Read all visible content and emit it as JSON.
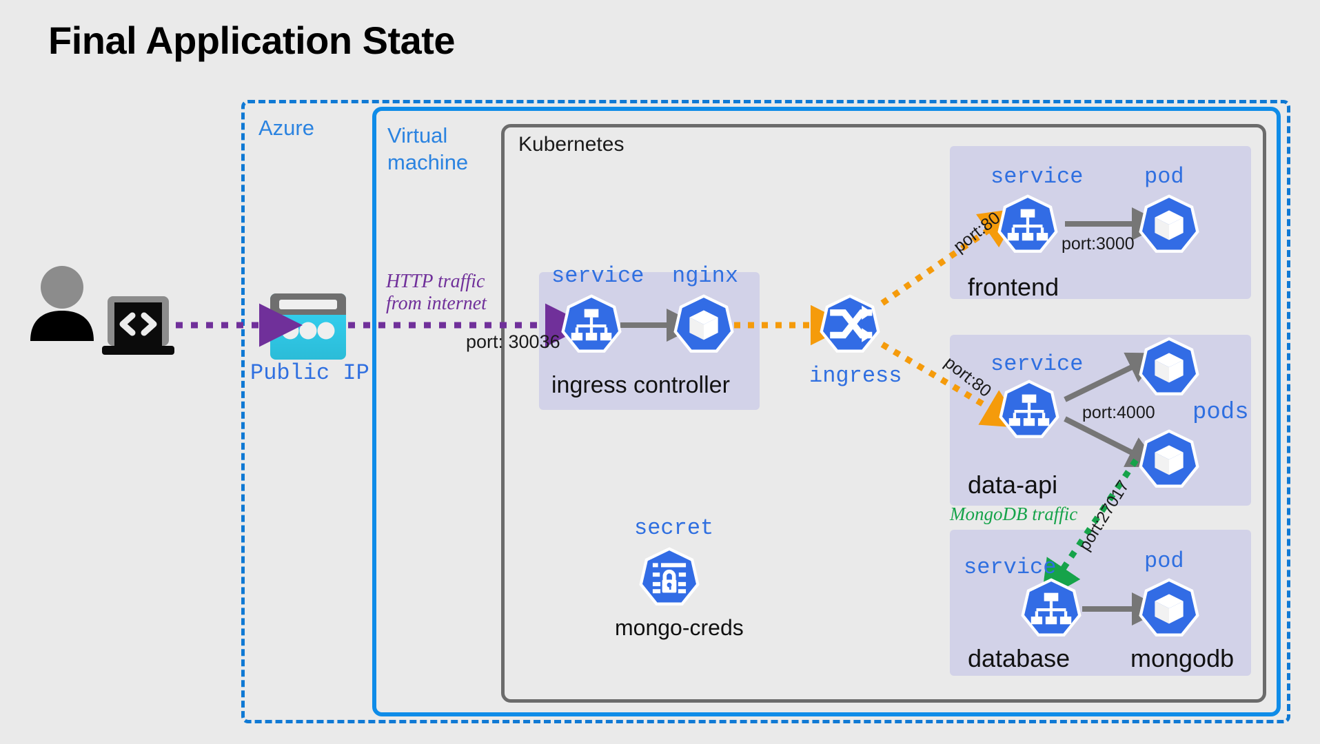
{
  "title": "Final Application State",
  "containers": {
    "azure": "Azure",
    "vm_line1": "Virtual",
    "vm_line2": "machine",
    "kubernetes": "Kubernetes"
  },
  "actors": {
    "user_icon": "user-icon",
    "laptop_icon": "laptop-code-icon"
  },
  "public_ip": {
    "label": "Public IP",
    "icon": "public-ip-icon"
  },
  "traffic": {
    "http_line1": "HTTP traffic",
    "http_line2": "from internet",
    "http_color": "#70309a",
    "nodeport": "port: 30036",
    "mongo_label": "MongoDB traffic",
    "mongo_color": "#16a34a",
    "mongo_port": "port:27017",
    "ingress_port_frontend": "port:80",
    "ingress_port_dataapi": "port:80"
  },
  "ingress_controller": {
    "service_label": "service",
    "pod_label": "nginx",
    "group_label": "ingress controller"
  },
  "ingress": {
    "label": "ingress",
    "icon": "ingress-shuffle-icon"
  },
  "secret": {
    "kind": "secret",
    "name": "mongo-creds",
    "icon": "secret-lock-icon"
  },
  "workloads": [
    {
      "name": "frontend",
      "service_label": "service",
      "pod_label": "pod",
      "target_port": "port:3000",
      "inbound_port": "port:80",
      "pod_count": 1
    },
    {
      "name": "data-api",
      "service_label": "service",
      "pod_label": "pods",
      "target_port": "port:4000",
      "inbound_port": "port:80",
      "pod_count": 2
    },
    {
      "name": "database",
      "service_label": "service",
      "pod_label": "pod",
      "pod_name": "mongodb",
      "target_port": "",
      "inbound_port": "port:27017",
      "pod_count": 1
    }
  ],
  "colors": {
    "background": "#eaeaea",
    "azure_border": "#0f79d4",
    "vm_border": "#0f8ce8",
    "k8s_border": "#6b6b6b",
    "group_fill": "#d2d2e8",
    "k8s_blue": "#326ce5",
    "arrow_gray": "#767676",
    "orange": "#f59b0b",
    "purple": "#70309a",
    "green": "#16a34a",
    "cyan": "#2fd2f2"
  }
}
